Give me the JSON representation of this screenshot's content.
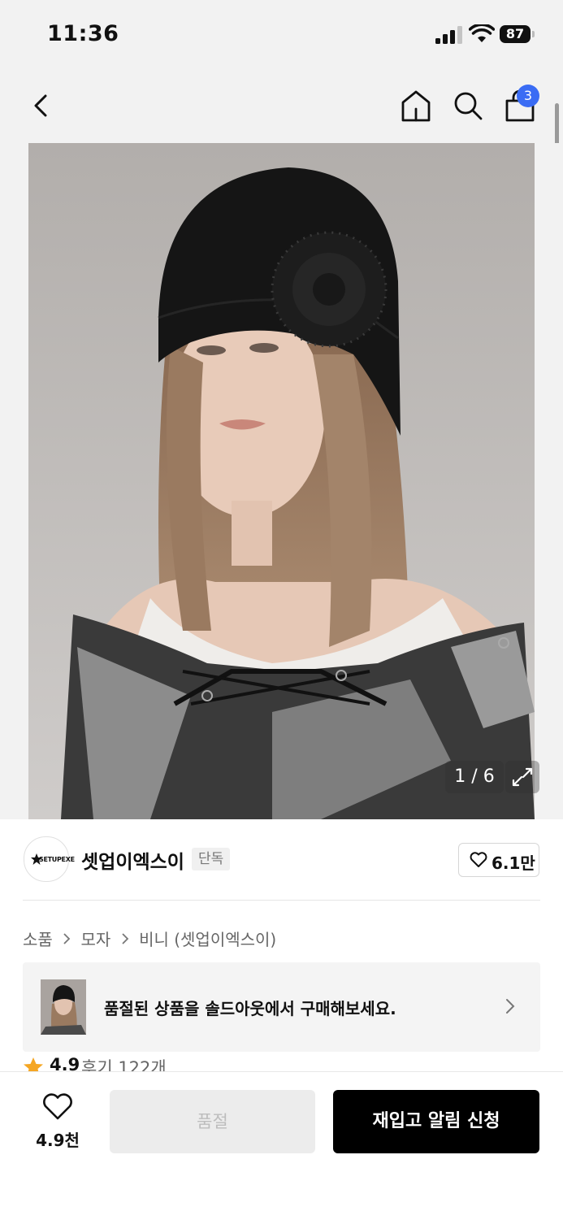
{
  "status_bar": {
    "time": "11:36",
    "battery": "87"
  },
  "nav": {
    "cart_count": "3"
  },
  "gallery": {
    "counter": "1 / 6"
  },
  "brand": {
    "logo_text": "SETUPEXE",
    "name": "셋업이엑스이",
    "tag": "단독",
    "likes": "6.1만"
  },
  "breadcrumb": {
    "items": [
      "소품",
      "모자",
      "비니 (셋업이엑스이)"
    ]
  },
  "soldout_banner": {
    "text": "품절된 상품을 솔드아웃에서 구매해보세요."
  },
  "rating": {
    "score": "4.9",
    "reviews": "후기 122개"
  },
  "bottom_bar": {
    "wish_count": "4.9천",
    "soldout_label": "품절",
    "restock_label": "재입고 알림 신청"
  },
  "colors": {
    "accent_blue": "#3a6cf4",
    "primary_button": "#000000",
    "star": "#f5a623"
  }
}
